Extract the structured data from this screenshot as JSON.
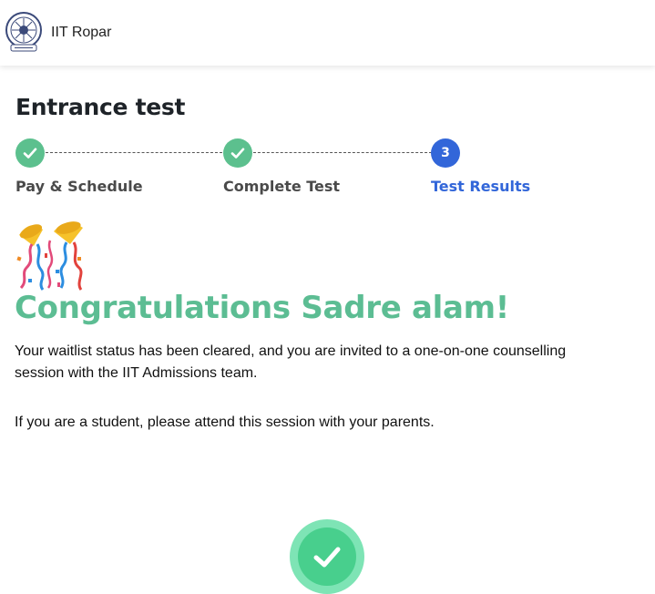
{
  "header": {
    "brand": "IIT Ropar",
    "logo_icon": "iit-ropar-seal-icon"
  },
  "page": {
    "title": "Entrance test"
  },
  "stepper": {
    "steps": [
      {
        "label": "Pay & Schedule",
        "state": "completed",
        "icon": "check-icon"
      },
      {
        "label": "Complete Test",
        "state": "completed",
        "icon": "check-icon"
      },
      {
        "label": "Test Results",
        "state": "active",
        "number": "3"
      }
    ]
  },
  "result": {
    "celebration_icon": "party-popper-icon",
    "heading": "Congratulations Sadre alam!",
    "message_1": "Your waitlist status has been cleared, and you are invited to a one-on-one counselling session with the IIT Admissions team.",
    "message_2": "If you are a student, please attend this session with your parents.",
    "success_icon": "success-check-icon"
  },
  "colors": {
    "completed": "#5cc08e",
    "active": "#3266d9",
    "heading": "#5cbd93",
    "success_outer": "#7ee4b5",
    "success_inner": "#48cf8d"
  }
}
